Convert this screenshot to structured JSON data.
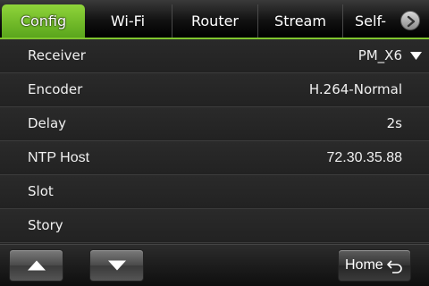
{
  "tabs": [
    {
      "label": "Config",
      "active": true
    },
    {
      "label": "Wi-Fi",
      "active": false
    },
    {
      "label": "Router",
      "active": false
    },
    {
      "label": "Stream",
      "active": false
    },
    {
      "label": "Self-",
      "active": false
    }
  ],
  "settings": [
    {
      "label": "Receiver",
      "value": "PM_X6",
      "dropdown": true
    },
    {
      "label": "Encoder",
      "value": "H.264-Normal"
    },
    {
      "label": "Delay",
      "value": "2s"
    },
    {
      "label": "NTP Host",
      "value": "72.30.35.88"
    },
    {
      "label": "Slot",
      "value": ""
    },
    {
      "label": "Story",
      "value": ""
    }
  ],
  "bottom": {
    "home_label": "Home"
  },
  "colors": {
    "accent": "#7fc52e",
    "background": "#242424"
  }
}
